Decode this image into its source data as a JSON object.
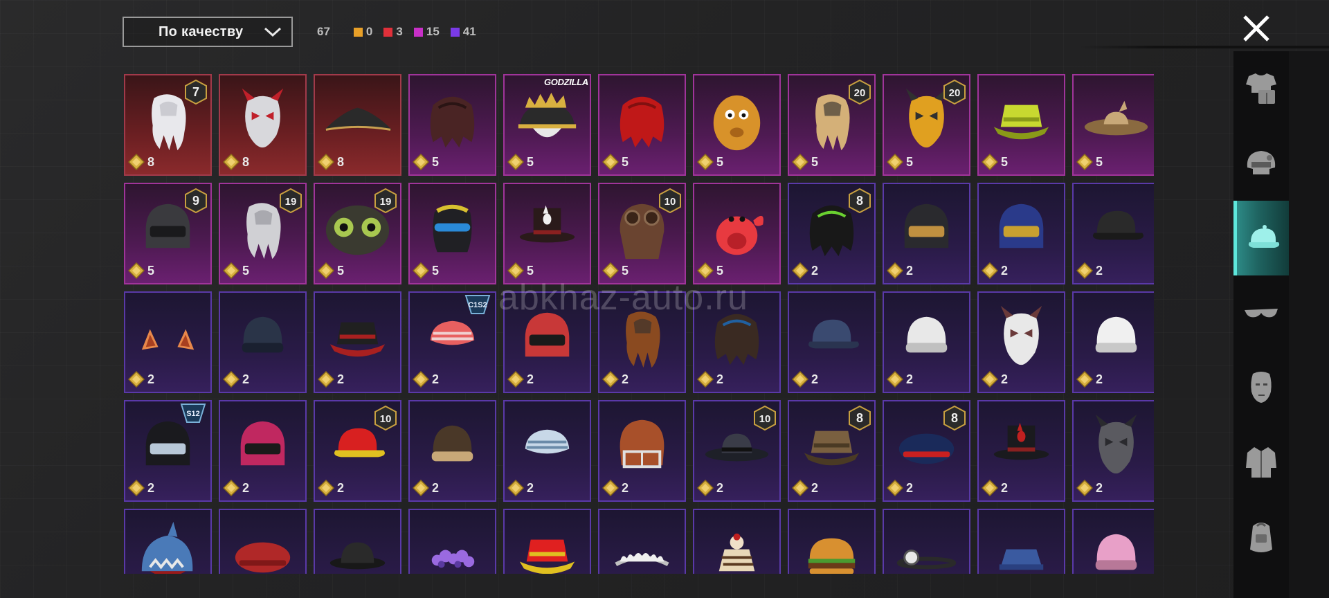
{
  "sort": {
    "label": "По качеству",
    "icon": "chevron-down-icon"
  },
  "counts": {
    "total": "67",
    "chips": [
      {
        "value": "0",
        "color": "#e8a028"
      },
      {
        "value": "3",
        "color": "#e0303a"
      },
      {
        "value": "15",
        "color": "#c830c8"
      },
      {
        "value": "41",
        "color": "#7a3ae6"
      }
    ]
  },
  "close_icon": "close-icon",
  "watermark": "abkhaz-auto.ru",
  "sidebar_tabs": [
    {
      "icon": "outfit-icon",
      "active": false
    },
    {
      "icon": "helmet-icon",
      "active": false
    },
    {
      "icon": "cap-icon",
      "active": true
    },
    {
      "icon": "glasses-icon",
      "active": false
    },
    {
      "icon": "face-mask-icon",
      "active": false
    },
    {
      "icon": "jacket-icon",
      "active": false
    },
    {
      "icon": "backpack-icon",
      "active": false
    }
  ],
  "items": [
    {
      "q": "red",
      "pts": "8",
      "badge": "7",
      "kind": "wig",
      "c1": "#e8e8ec",
      "c2": "#b8b8c0"
    },
    {
      "q": "red",
      "pts": "8",
      "kind": "mask",
      "c1": "#d8d8dc",
      "c2": "#c0202a"
    },
    {
      "q": "red",
      "pts": "8",
      "kind": "tricorn",
      "c1": "#2a2a2a",
      "c2": "#c9a050"
    },
    {
      "q": "pink",
      "pts": "5",
      "kind": "hair",
      "c1": "#4a2424",
      "c2": "#2a1414"
    },
    {
      "q": "pink",
      "pts": "5",
      "brand": "GODZILLA",
      "kind": "spikycap",
      "c1": "#2a2a2a",
      "c2": "#d8b040"
    },
    {
      "q": "pink",
      "pts": "5",
      "kind": "hair",
      "c1": "#c01818",
      "c2": "#801010"
    },
    {
      "q": "pink",
      "pts": "5",
      "kind": "blob",
      "c1": "#d8922a",
      "c2": "#a86418"
    },
    {
      "q": "pink",
      "pts": "5",
      "badge": "20",
      "kind": "wig",
      "c1": "#d4b078",
      "c2": "#2a2a2a"
    },
    {
      "q": "pink",
      "pts": "5",
      "badge": "20",
      "kind": "mask",
      "c1": "#e0a020",
      "c2": "#303030"
    },
    {
      "q": "pink",
      "pts": "5",
      "kind": "bucket",
      "c1": "#c8d830",
      "c2": "#8a9a18"
    },
    {
      "q": "pink",
      "pts": "5",
      "kind": "strawhat",
      "c1": "#c8a878",
      "c2": "#8a6a40"
    },
    {
      "q": "pink",
      "pts": "5",
      "badge": "9",
      "kind": "helmet",
      "c1": "#3a3a3e",
      "c2": "#1a1a1c"
    },
    {
      "q": "pink",
      "pts": "5",
      "badge": "19",
      "kind": "wig",
      "c1": "#d0d0d4",
      "c2": "#909096"
    },
    {
      "q": "pink",
      "pts": "5",
      "badge": "19",
      "kind": "goggles",
      "c1": "#3a3a30",
      "c2": "#a8c850"
    },
    {
      "q": "pink",
      "pts": "5",
      "kind": "balaclava",
      "c1": "#202024",
      "c2": "#2a8ad8"
    },
    {
      "q": "pink",
      "pts": "5",
      "kind": "tophat",
      "c1": "#2a1a1a",
      "c2": "#f0f0f0"
    },
    {
      "q": "pink",
      "pts": "5",
      "badge": "10",
      "kind": "aviator",
      "c1": "#6a4430",
      "c2": "#3a2418"
    },
    {
      "q": "pink",
      "pts": "5",
      "kind": "crab",
      "c1": "#e83a40",
      "c2": "#b82028"
    },
    {
      "q": "purple",
      "pts": "2",
      "badge": "8",
      "kind": "hair",
      "c1": "#181818",
      "c2": "#6ad030"
    },
    {
      "q": "purple",
      "pts": "2",
      "kind": "helmet",
      "c1": "#2a2a2e",
      "c2": "#c09040"
    },
    {
      "q": "purple",
      "pts": "2",
      "kind": "helmet",
      "c1": "#2a3a8a",
      "c2": "#c8a030"
    },
    {
      "q": "purple",
      "pts": "2",
      "kind": "cap",
      "c1": "#2a2a2a",
      "c2": "#1a1a1a"
    },
    {
      "q": "purple",
      "pts": "2",
      "kind": "ears",
      "c1": "#e8884a",
      "c2": "#a84020"
    },
    {
      "q": "purple",
      "pts": "2",
      "kind": "beanie",
      "c1": "#2a3448",
      "c2": "#1a2030"
    },
    {
      "q": "purple",
      "pts": "2",
      "kind": "bucket",
      "c1": "#202020",
      "c2": "#a82020"
    },
    {
      "q": "purple",
      "pts": "2",
      "season": "C1S2",
      "kind": "bandana",
      "c1": "#e86060",
      "c2": "#f0d0d0"
    },
    {
      "q": "purple",
      "pts": "2",
      "kind": "helmet",
      "c1": "#c83838",
      "c2": "#1a1a1a"
    },
    {
      "q": "purple",
      "pts": "2",
      "kind": "wig",
      "c1": "#8a4a20",
      "c2": "#303030"
    },
    {
      "q": "purple",
      "pts": "2",
      "kind": "hair",
      "c1": "#3a2a22",
      "c2": "#2060a0"
    },
    {
      "q": "purple",
      "pts": "2",
      "kind": "cap",
      "c1": "#3a4a70",
      "c2": "#2a3450"
    },
    {
      "q": "purple",
      "pts": "2",
      "kind": "beanie",
      "c1": "#e8e8e8",
      "c2": "#c0c0c0"
    },
    {
      "q": "purple",
      "pts": "2",
      "kind": "mask",
      "c1": "#e8e8e8",
      "c2": "#6a3a3a"
    },
    {
      "q": "purple",
      "pts": "2",
      "kind": "beanie",
      "c1": "#f0f0f0",
      "c2": "#c8c8c8"
    },
    {
      "q": "purple",
      "pts": "2",
      "season": "S12",
      "kind": "helmet",
      "c1": "#1a1a1e",
      "c2": "#b8c8d8"
    },
    {
      "q": "purple",
      "pts": "2",
      "kind": "helmet",
      "c1": "#c02860",
      "c2": "#1a1a1a"
    },
    {
      "q": "purple",
      "pts": "2",
      "badge": "10",
      "kind": "cap",
      "c1": "#d82020",
      "c2": "#e0c020"
    },
    {
      "q": "purple",
      "pts": "2",
      "kind": "beanie",
      "c1": "#4a3828",
      "c2": "#c8a878"
    },
    {
      "q": "purple",
      "pts": "2",
      "kind": "bandana",
      "c1": "#c8d8e8",
      "c2": "#6a8aa8"
    },
    {
      "q": "purple",
      "pts": "2",
      "kind": "football",
      "c1": "#a8502a",
      "c2": "#e0e0e0"
    },
    {
      "q": "purple",
      "pts": "2",
      "badge": "10",
      "kind": "fedora",
      "c1": "#1e2028",
      "c2": "#3a3c48"
    },
    {
      "q": "purple",
      "pts": "2",
      "badge": "8",
      "kind": "bucket",
      "c1": "#7a6040",
      "c2": "#4a3a24"
    },
    {
      "q": "purple",
      "pts": "2",
      "badge": "8",
      "kind": "beret",
      "c1": "#1a2a5a",
      "c2": "#c82020"
    },
    {
      "q": "purple",
      "pts": "2",
      "kind": "tophat",
      "c1": "#1a1a1e",
      "c2": "#c02020"
    },
    {
      "q": "purple",
      "pts": "2",
      "kind": "mask",
      "c1": "#5a5a60",
      "c2": "#2a2a2e"
    },
    {
      "q": "purple",
      "kind": "shark",
      "c1": "#4a7ab8",
      "c2": "#e8e8e8"
    },
    {
      "q": "purple",
      "kind": "beret",
      "c1": "#b02828",
      "c2": "#801818"
    },
    {
      "q": "purple",
      "kind": "bowler",
      "c1": "#181818",
      "c2": "#2a2a2a"
    },
    {
      "q": "purple",
      "kind": "flowers",
      "c1": "#9a6ae0",
      "c2": "#5a3aa0"
    },
    {
      "q": "purple",
      "kind": "bucket",
      "c1": "#e02020",
      "c2": "#e0c020"
    },
    {
      "q": "purple",
      "kind": "tiara",
      "c1": "#f0f0f0",
      "c2": "#c0c0c0"
    },
    {
      "q": "purple",
      "kind": "cake",
      "c1": "#e8d8b8",
      "c2": "#5a3a20"
    },
    {
      "q": "purple",
      "kind": "burger",
      "c1": "#d89030",
      "c2": "#6a3a18"
    },
    {
      "q": "purple",
      "kind": "headlamp",
      "c1": "#2a2a2a",
      "c2": "#e8e8e8"
    },
    {
      "q": "purple",
      "kind": "nursecap",
      "c1": "#3a5aa0",
      "c2": "#2a4080"
    },
    {
      "q": "purple",
      "kind": "beanie",
      "c1": "#e8a0c8",
      "c2": "#b87898"
    }
  ]
}
